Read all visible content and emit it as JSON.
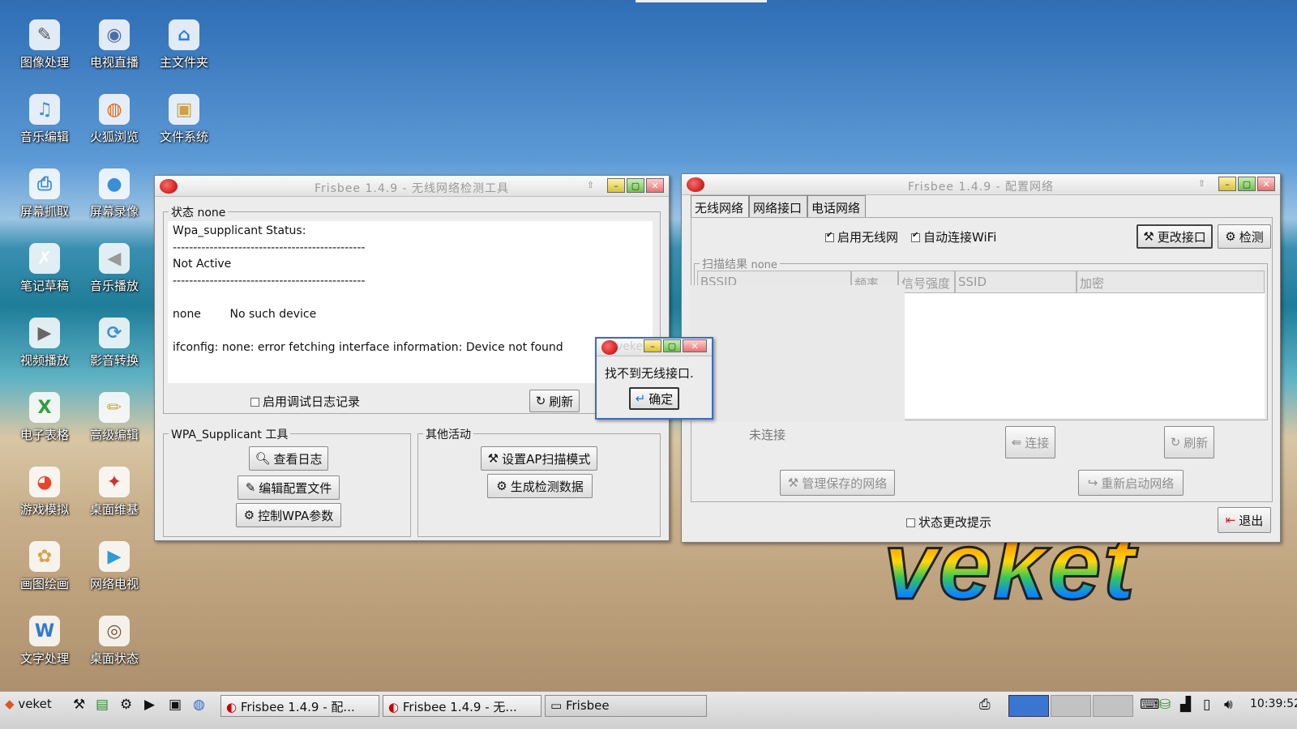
{
  "desktop": {
    "icons": [
      {
        "label": "图像处理",
        "icon": "gimp-icon",
        "glyph": "✎",
        "color": "#555"
      },
      {
        "label": "电视直播",
        "icon": "tv-icon",
        "glyph": "◉",
        "color": "#4a6fa5"
      },
      {
        "label": "主文件夹",
        "icon": "home-folder-icon",
        "glyph": "⌂",
        "color": "#2b7de9"
      },
      {
        "label": "音乐编辑",
        "icon": "audio-edit-icon",
        "glyph": "♫",
        "color": "#3b8ed8"
      },
      {
        "label": "火狐浏览",
        "icon": "firefox-icon",
        "glyph": "◍",
        "color": "#e8661b"
      },
      {
        "label": "文件系统",
        "icon": "file-system-icon",
        "glyph": "▣",
        "color": "#c9a24a"
      },
      {
        "label": "屏幕抓取",
        "icon": "screenshot-icon",
        "glyph": "⎙",
        "color": "#3b8ed8"
      },
      {
        "label": "屏幕录像",
        "icon": "screen-record-icon",
        "glyph": "●",
        "color": "#3b8ed8"
      },
      {
        "label": "笔记草稿",
        "icon": "notepad-icon",
        "glyph": "✗",
        "color": "#ffffff"
      },
      {
        "label": "音乐播放",
        "icon": "speaker-icon",
        "glyph": "◀",
        "color": "#999"
      },
      {
        "label": "视频播放",
        "icon": "video-player-icon",
        "glyph": "▶",
        "color": "#666"
      },
      {
        "label": "影音转换",
        "icon": "media-convert-icon",
        "glyph": "⟳",
        "color": "#3b8ed8"
      },
      {
        "label": "电子表格",
        "icon": "spreadsheet-icon",
        "glyph": "X",
        "color": "#2e9e3c"
      },
      {
        "label": "高级编辑",
        "icon": "advanced-editor-icon",
        "glyph": "✏",
        "color": "#d9a534"
      },
      {
        "label": "游戏模拟",
        "icon": "game-emulator-icon",
        "glyph": "◕",
        "color": "#e9432c"
      },
      {
        "label": "桌面维基",
        "icon": "desktop-wiki-icon",
        "glyph": "✦",
        "color": "#d62f2f"
      },
      {
        "label": "画图绘画",
        "icon": "paint-icon",
        "glyph": "✿",
        "color": "#d8a24a"
      },
      {
        "label": "网络电视",
        "icon": "network-tv-icon",
        "glyph": "▶",
        "color": "#2f9ad8"
      },
      {
        "label": "文字处理",
        "icon": "word-processor-icon",
        "glyph": "W",
        "color": "#2f78d8"
      },
      {
        "label": "桌面状态",
        "icon": "desktop-status-icon",
        "glyph": "◎",
        "color": "#7a5a3a"
      }
    ],
    "brand": "veket"
  },
  "win1": {
    "title": "Frisbee  1.4.9 - 无线网络检测工具",
    "status_label": "状态",
    "status_value": "none",
    "log_lines": [
      "Wpa_supplicant Status:",
      "-----------------------------------------------",
      "Not Active",
      "-----------------------------------------------",
      "",
      "none        No such device",
      "",
      "ifconfig: none: error fetching interface information: Device not found"
    ],
    "debug_checkbox": "启用调试日志记录",
    "refresh": "刷新",
    "wpa_group": "WPA_Supplicant 工具",
    "view_log": "查看日志",
    "edit_config": "编辑配置文件",
    "control_wpa": "控制WPA参数",
    "other_group": "其他活动",
    "set_ap_scan": "设置AP扫描模式",
    "gen_diag": "生成检测数据"
  },
  "win2": {
    "title": "Frisbee  1.4.9 - 配置网络",
    "tabs": [
      "无线网络",
      "网络接口",
      "电话网络"
    ],
    "enable_wireless": "启用无线网",
    "auto_connect": "自动连接WiFi",
    "change_interface": "更改接口",
    "detect": "检测",
    "scan_label": "扫描结果",
    "scan_value": "none",
    "columns": [
      "BSSID",
      "频率",
      "信号强度",
      "SSID",
      "加密"
    ],
    "not_connected": "未连接",
    "connect": "连接",
    "refresh": "刷新",
    "manage_saved": "管理保存的网络",
    "restart_network": "重新启动网络",
    "status_change_hint": "状态更改提示",
    "exit": "退出"
  },
  "dialog": {
    "title": "veket",
    "message": "找不到无线接口.",
    "ok": "确定"
  },
  "taskbar": {
    "start": "veket",
    "tasks": [
      "Frisbee  1.4.9 - 配...",
      "Frisbee  1.4.9 - 无...",
      "Frisbee"
    ],
    "clock": "10:39:52"
  }
}
